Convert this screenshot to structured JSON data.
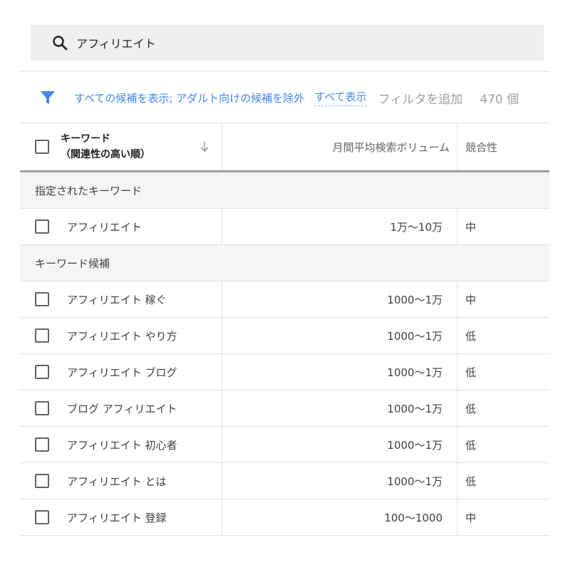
{
  "search": {
    "value": "アフィリエイト"
  },
  "filter_bar": {
    "description": "すべての候補を表示; アダルト向けの候補を除外",
    "show_all": "すべて表示",
    "add_filter": "フィルタを追加",
    "count": "470 個"
  },
  "table": {
    "headers": {
      "keyword_line1": "キーワード",
      "keyword_line2": "（関連性の高い順）",
      "volume": "月間平均検索ボリューム",
      "competition": "競合性"
    },
    "sections": {
      "specified": "指定されたキーワード",
      "suggestions": "キーワード候補"
    },
    "specified_rows": [
      {
        "keyword": "アフィリエイト",
        "volume": "1万～10万",
        "competition": "中"
      }
    ],
    "suggestion_rows": [
      {
        "keyword": "アフィリエイト 稼ぐ",
        "volume": "1000～1万",
        "competition": "中"
      },
      {
        "keyword": "アフィリエイト やり方",
        "volume": "1000～1万",
        "competition": "低"
      },
      {
        "keyword": "アフィリエイト ブログ",
        "volume": "1000～1万",
        "competition": "低"
      },
      {
        "keyword": "ブログ アフィリエイト",
        "volume": "1000～1万",
        "competition": "低"
      },
      {
        "keyword": "アフィリエイト 初心者",
        "volume": "1000～1万",
        "competition": "低"
      },
      {
        "keyword": "アフィリエイト とは",
        "volume": "1000～1万",
        "competition": "低"
      },
      {
        "keyword": "アフィリエイト 登録",
        "volume": "100～1000",
        "competition": "中"
      }
    ]
  },
  "colors": {
    "accent": "#4285f4",
    "muted": "#9e9e9e",
    "text": "#3c4043"
  },
  "icons": {
    "search": "search-icon",
    "filter": "filter-icon",
    "sort": "arrow-down-icon"
  }
}
